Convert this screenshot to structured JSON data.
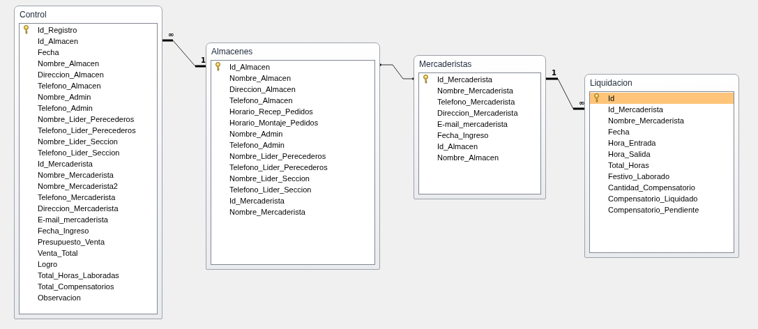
{
  "tables": [
    {
      "title": "Control",
      "fields": [
        {
          "name": "Id_Registro",
          "key": true,
          "selected": false
        },
        {
          "name": "Id_Almacen",
          "key": false,
          "selected": false
        },
        {
          "name": "Fecha",
          "key": false,
          "selected": false
        },
        {
          "name": "Nombre_Almacen",
          "key": false,
          "selected": false
        },
        {
          "name": "Direccion_Almacen",
          "key": false,
          "selected": false
        },
        {
          "name": "Telefono_Almacen",
          "key": false,
          "selected": false
        },
        {
          "name": "Nombre_Admin",
          "key": false,
          "selected": false
        },
        {
          "name": "Telefono_Admin",
          "key": false,
          "selected": false
        },
        {
          "name": "Nombre_Lider_Perecederos",
          "key": false,
          "selected": false
        },
        {
          "name": "Telefono_Lider_Perecederos",
          "key": false,
          "selected": false
        },
        {
          "name": "Nombre_Lider_Seccion",
          "key": false,
          "selected": false
        },
        {
          "name": "Telefono_Lider_Seccion",
          "key": false,
          "selected": false
        },
        {
          "name": "Id_Mercaderista",
          "key": false,
          "selected": false
        },
        {
          "name": "Nombre_Mercaderista",
          "key": false,
          "selected": false
        },
        {
          "name": "Nombre_Mercaderista2",
          "key": false,
          "selected": false
        },
        {
          "name": "Telefono_Mercaderista",
          "key": false,
          "selected": false
        },
        {
          "name": "Direccion_Mercaderista",
          "key": false,
          "selected": false
        },
        {
          "name": "E-mail_mercaderista",
          "key": false,
          "selected": false
        },
        {
          "name": "Fecha_Ingreso",
          "key": false,
          "selected": false
        },
        {
          "name": "Presupuesto_Venta",
          "key": false,
          "selected": false
        },
        {
          "name": "Venta_Total",
          "key": false,
          "selected": false
        },
        {
          "name": "Logro",
          "key": false,
          "selected": false
        },
        {
          "name": "Total_Horas_Laboradas",
          "key": false,
          "selected": false
        },
        {
          "name": "Total_Compensatorios",
          "key": false,
          "selected": false
        },
        {
          "name": "Observacion",
          "key": false,
          "selected": false
        }
      ]
    },
    {
      "title": "Almacenes",
      "fields": [
        {
          "name": "Id_Almacen",
          "key": true,
          "selected": false
        },
        {
          "name": "Nombre_Almacen",
          "key": false,
          "selected": false
        },
        {
          "name": "Direccion_Almacen",
          "key": false,
          "selected": false
        },
        {
          "name": "Telefono_Almacen",
          "key": false,
          "selected": false
        },
        {
          "name": "Horario_Recep_Pedidos",
          "key": false,
          "selected": false
        },
        {
          "name": "Horario_Montaje_Pedidos",
          "key": false,
          "selected": false
        },
        {
          "name": "Nombre_Admin",
          "key": false,
          "selected": false
        },
        {
          "name": "Telefono_Admin",
          "key": false,
          "selected": false
        },
        {
          "name": "Nombre_Lider_Perecederos",
          "key": false,
          "selected": false
        },
        {
          "name": "Telefono_Lider_Perecederos",
          "key": false,
          "selected": false
        },
        {
          "name": "Nombre_Lider_Seccion",
          "key": false,
          "selected": false
        },
        {
          "name": "Telefono_Lider_Seccion",
          "key": false,
          "selected": false
        },
        {
          "name": "Id_Mercaderista",
          "key": false,
          "selected": false
        },
        {
          "name": "Nombre_Mercaderista",
          "key": false,
          "selected": false
        }
      ]
    },
    {
      "title": "Mercaderistas",
      "fields": [
        {
          "name": "Id_Mercaderista",
          "key": true,
          "selected": false
        },
        {
          "name": "Nombre_Mercaderista",
          "key": false,
          "selected": false
        },
        {
          "name": "Telefono_Mercaderista",
          "key": false,
          "selected": false
        },
        {
          "name": "Direccion_Mercaderista",
          "key": false,
          "selected": false
        },
        {
          "name": "E-mail_mercaderista",
          "key": false,
          "selected": false
        },
        {
          "name": "Fecha_Ingreso",
          "key": false,
          "selected": false
        },
        {
          "name": "Id_Almacen",
          "key": false,
          "selected": false
        },
        {
          "name": "Nombre_Almacen",
          "key": false,
          "selected": false
        }
      ]
    },
    {
      "title": "Liquidacion",
      "fields": [
        {
          "name": "Id",
          "key": true,
          "selected": true
        },
        {
          "name": "Id_Mercaderista",
          "key": false,
          "selected": false
        },
        {
          "name": "Nombre_Mercaderista",
          "key": false,
          "selected": false
        },
        {
          "name": "Fecha",
          "key": false,
          "selected": false
        },
        {
          "name": "Hora_Entrada",
          "key": false,
          "selected": false
        },
        {
          "name": "Hora_Salida",
          "key": false,
          "selected": false
        },
        {
          "name": "Total_Horas",
          "key": false,
          "selected": false
        },
        {
          "name": "Festivo_Laborado",
          "key": false,
          "selected": false
        },
        {
          "name": "Cantidad_Compensatorio",
          "key": false,
          "selected": false
        },
        {
          "name": "Compensatorio_Liquidado",
          "key": false,
          "selected": false
        },
        {
          "name": "Compensatorio_Pendiente",
          "key": false,
          "selected": false
        }
      ]
    }
  ],
  "relationships": [
    {
      "kind": "enforced",
      "from_label": "∞",
      "to_label": "1"
    },
    {
      "kind": "plain"
    },
    {
      "kind": "enforced",
      "from_label": "1",
      "to_label": "∞"
    }
  ]
}
